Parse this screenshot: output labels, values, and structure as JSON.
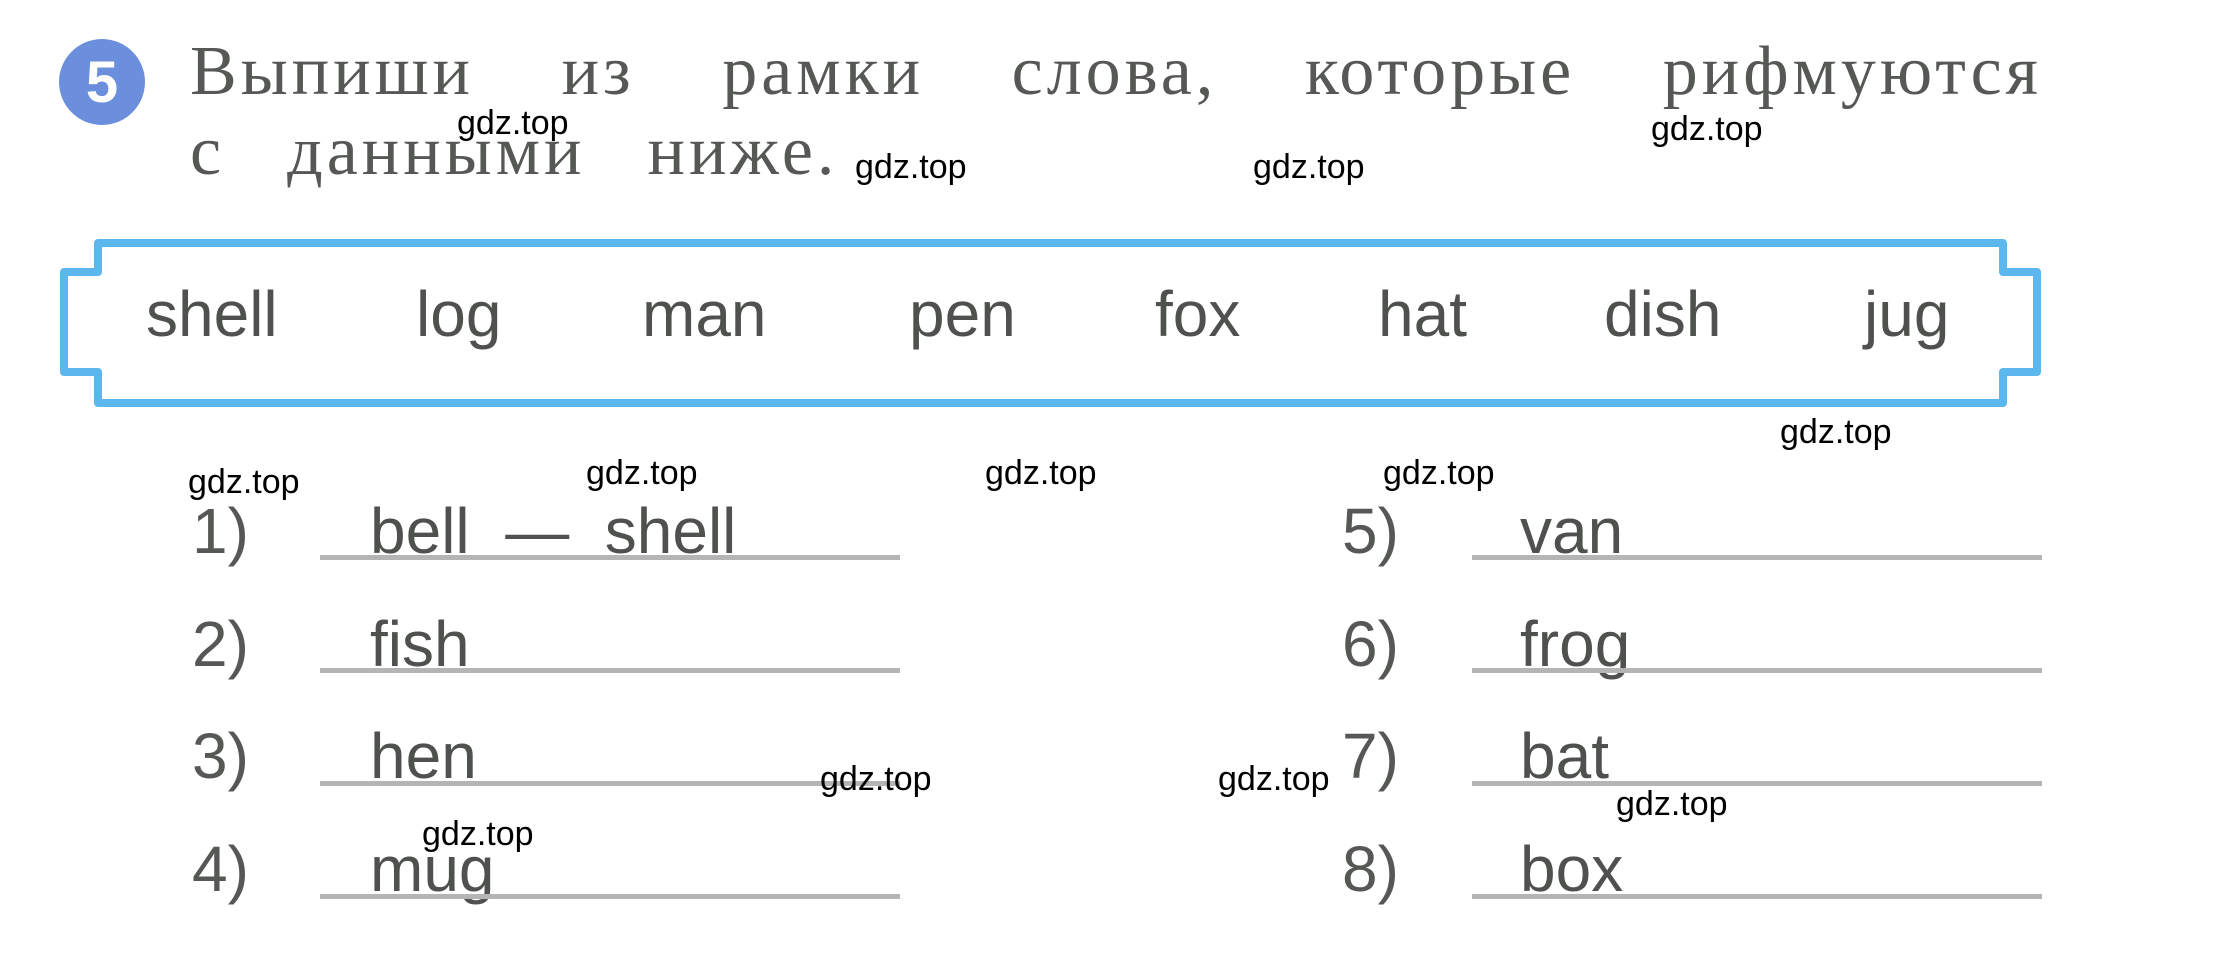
{
  "exercise": {
    "number": "5",
    "badge_color": "#6b8fdc",
    "instruction_line1": [
      "Выпиши",
      "из",
      "рамки",
      "слова,",
      "которые",
      "рифмуются"
    ],
    "instruction_line2": [
      "с",
      "данными",
      "ниже."
    ]
  },
  "word_box": {
    "border_color": "#5cb8ec",
    "words": [
      "shell",
      "log",
      "man",
      "pen",
      "fox",
      "hat",
      "dish",
      "jug"
    ]
  },
  "items": [
    {
      "label": "1)",
      "text": "bell  —  shell"
    },
    {
      "label": "2)",
      "text": "fish"
    },
    {
      "label": "3)",
      "text": "hen"
    },
    {
      "label": "4)",
      "text": "mug"
    },
    {
      "label": "5)",
      "text": "van"
    },
    {
      "label": "6)",
      "text": "frog"
    },
    {
      "label": "7)",
      "text": "bat"
    },
    {
      "label": "8)",
      "text": "box"
    }
  ],
  "watermark": "gdz.top"
}
